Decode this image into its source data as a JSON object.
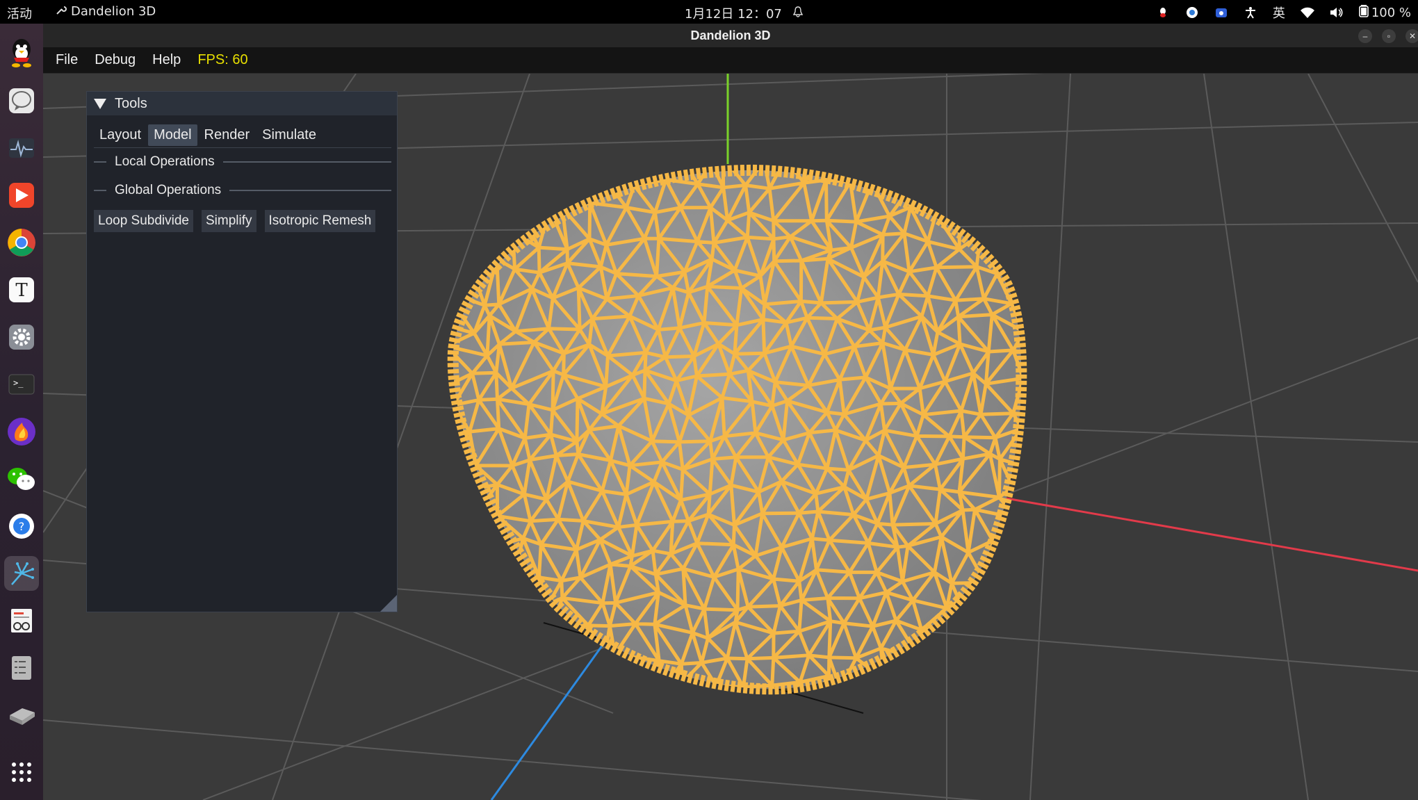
{
  "topbar": {
    "activities": "活动",
    "app_name": "Dandelion 3D",
    "datetime": "1月12日  12：07",
    "input_method": "英",
    "battery": "100 %"
  },
  "window": {
    "title": "Dandelion 3D",
    "controls": [
      "–",
      "▫",
      "✕"
    ]
  },
  "menubar": {
    "items": [
      "File",
      "Debug",
      "Help"
    ],
    "fps": "FPS: 60"
  },
  "tools_panel": {
    "title": "Tools",
    "tabs": [
      "Layout",
      "Model",
      "Render",
      "Simulate"
    ],
    "active_tab": "Model",
    "sections": [
      "Local Operations",
      "Global Operations"
    ],
    "buttons": [
      "Loop Subdivide",
      "Simplify",
      "Isotropic Remesh"
    ]
  },
  "dock": {
    "apps": [
      "qq-icon",
      "chat-bubble-icon",
      "system-monitor-icon",
      "media-player-icon",
      "chrome-icon",
      "typora-icon",
      "settings-icon",
      "terminal-icon",
      "firefox-dev-icon",
      "wechat-icon",
      "help-icon",
      "dandelion-icon",
      "document-viewer-icon",
      "text-editor-icon",
      "drive-icon",
      "app-grid-icon"
    ]
  },
  "colors": {
    "mesh_wire": "#f6b846",
    "mesh_fill": "#9a9a9a",
    "axis_x": "#e23a4a",
    "axis_y": "#7bd12a",
    "axis_z": "#2d8ae0",
    "fps": "#e8e000"
  }
}
